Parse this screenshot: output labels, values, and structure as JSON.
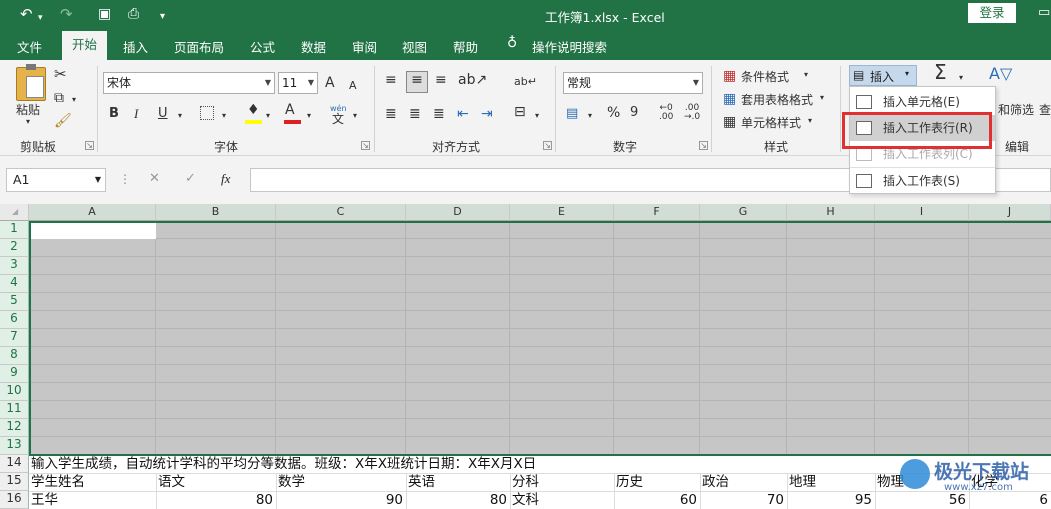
{
  "titlebar": {
    "title": "工作簿1.xlsx  -  Excel",
    "login": "登录",
    "qa_undo": "↶",
    "qa_redo": "↷",
    "qa_save": "💾",
    "qa_preview": "🗋",
    "qa_more": "≡"
  },
  "tabs": [
    "文件",
    "开始",
    "插入",
    "页面布局",
    "公式",
    "数据",
    "审阅",
    "视图",
    "帮助"
  ],
  "tell_me": "操作说明搜索",
  "clipboard": {
    "paste": "粘贴",
    "group": "剪贴板"
  },
  "font": {
    "name": "宋体",
    "size": "11",
    "group": "字体",
    "bold": "B",
    "italic": "I",
    "underline": "U",
    "grow": "A",
    "shrink": "A",
    "color_letter": "A",
    "wen": "wén"
  },
  "align": {
    "group": "对齐方式"
  },
  "number": {
    "format": "常规",
    "percent": "%",
    "comma": "9",
    "group": "数字"
  },
  "styles": {
    "cond": "条件格式",
    "table": "套用表格格式",
    "cell": "单元格样式",
    "group": "样式"
  },
  "cells": {
    "insert": "插入"
  },
  "edit": {
    "sigma": "Σ",
    "sort": "和筛选",
    "find": "查",
    "group": "编辑"
  },
  "menu": [
    {
      "label": "插入单元格(E)",
      "enabled": true
    },
    {
      "label": "插入工作表行(R)",
      "enabled": true
    },
    {
      "label": "插入工作表列(C)",
      "enabled": false
    },
    {
      "label": "插入工作表(S)",
      "enabled": true
    }
  ],
  "formula": {
    "namebox": "A1",
    "cancel": "✕",
    "enter": "✓",
    "fx": "fx",
    "value": ""
  },
  "columns": [
    "A",
    "B",
    "C",
    "D",
    "E",
    "F",
    "G",
    "H",
    "I",
    "J"
  ],
  "rows": [
    "1",
    "2",
    "3",
    "4",
    "5",
    "6",
    "7",
    "8",
    "9",
    "10",
    "11",
    "12",
    "13",
    "14",
    "15",
    "16"
  ],
  "row14": "输入学生成绩，自动统计学科的平均分等数据。班级：X年X班统计日期：X年X月X日",
  "row15": [
    "学生姓名",
    "语文",
    "数学",
    "英语",
    "分科",
    "历史",
    "政治",
    "地理",
    "物理",
    "化学"
  ],
  "row16": [
    "王华",
    "80",
    "90",
    "80",
    "文科",
    "60",
    "70",
    "95",
    "56",
    "6"
  ],
  "watermark": {
    "name": "极光下载站",
    "url": "www.xz7.com"
  },
  "colors": {
    "accent": "#217346",
    "highlight": "#e03030",
    "selected_fill": "#c6c6c6"
  }
}
